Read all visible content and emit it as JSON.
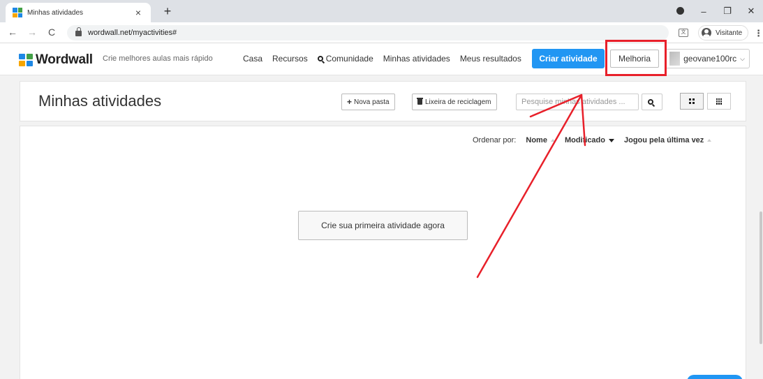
{
  "browser": {
    "tab_title": "Minhas atividades",
    "tab_close": "×",
    "new_tab": "+",
    "url": "wordwall.net/myactivities#",
    "profile_label": "Visitante",
    "translate_glyph": "文",
    "kebab": "⋮",
    "window": {
      "minimize": "–",
      "restore": "❐",
      "close": "✕"
    },
    "nav": {
      "back": "←",
      "forward": "→",
      "reload": "C"
    }
  },
  "header": {
    "logo_text": "Wordwall",
    "tagline": "Crie melhores aulas mais rápido",
    "nav": [
      "Casa",
      "Recursos",
      "Comunidade",
      "Minhas atividades",
      "Meus resultados"
    ],
    "create_button": "Criar atividade",
    "upgrade_button": "Melhoria",
    "username": "geovane100rc",
    "chevron": "⌵"
  },
  "toolbar": {
    "title": "Minhas atividades",
    "new_folder": "Nova pasta",
    "recycle_bin": "Lixeira de reciclagem",
    "search_placeholder": "Pesquise minhas atividades ..."
  },
  "sort": {
    "label": "Ordenar por:",
    "options": [
      "Nome",
      "Modificado",
      "Jogou pela última vez"
    ]
  },
  "empty_state": {
    "create_first": "Crie sua primeira atividade agora"
  },
  "colors": {
    "brand_blue": "#2196f3",
    "annotation_red": "#e8202a",
    "logo": [
      "#f7a600",
      "#1e88e5",
      "#43a047",
      "#e53935"
    ]
  }
}
